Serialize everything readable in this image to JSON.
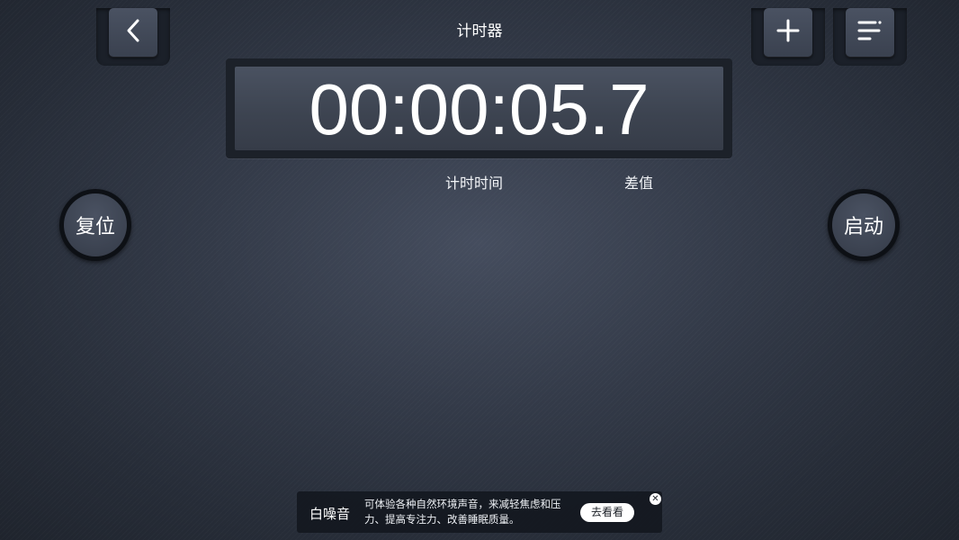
{
  "header": {
    "title": "计时器",
    "back_icon": "chevron-left-icon",
    "add_icon": "plus-icon",
    "menu_icon": "list-menu-icon"
  },
  "display": {
    "time": "00:00:05.7"
  },
  "labels": {
    "elapsed": "计时时间",
    "difference": "差值"
  },
  "controls": {
    "reset_label": "复位",
    "start_label": "启动"
  },
  "ad": {
    "title": "白噪音",
    "description": "可体验各种自然环境声音，来减轻焦虑和压力、提高专注力、改善睡眠质量。",
    "button_label": "去看看",
    "close_icon": "close-icon"
  },
  "colors": {
    "background": "#333a48",
    "button_face": "#3d4451",
    "text": "#ffffff"
  }
}
